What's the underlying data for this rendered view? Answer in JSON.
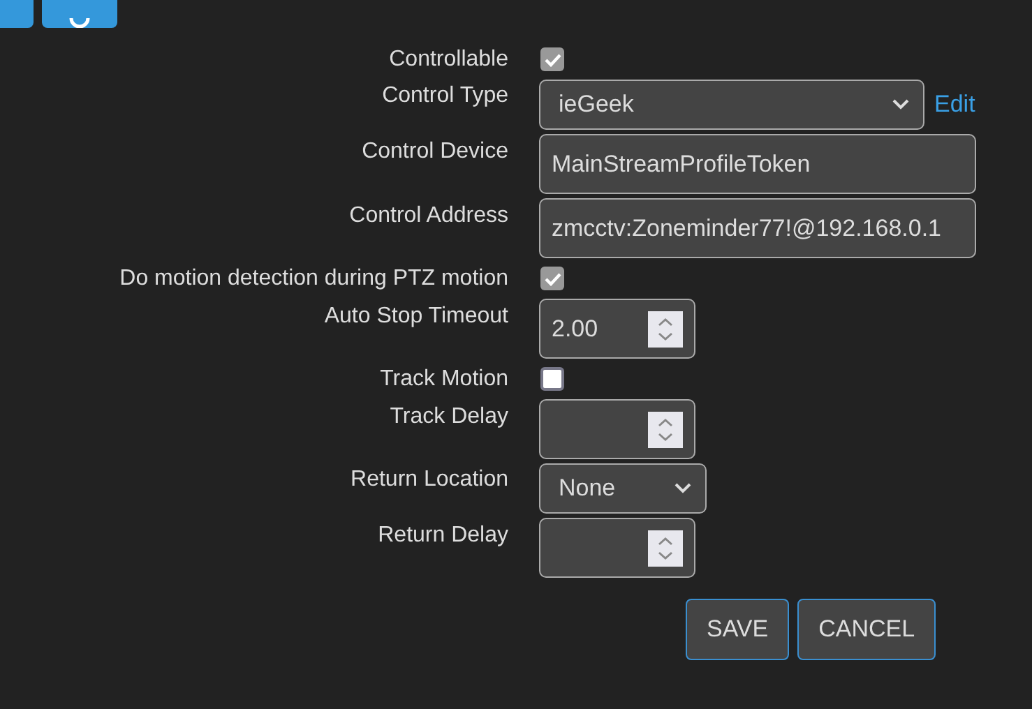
{
  "toolbar": {
    "buttons": [
      {
        "kind": "plain"
      },
      {
        "kind": "refresh"
      }
    ]
  },
  "fields": [
    {
      "label": "Controllable",
      "kind": "checkbox",
      "checked": true
    },
    {
      "label": "Control Type",
      "kind": "select",
      "value": "ieGeek",
      "link": "Edit"
    },
    {
      "label": "Control Device",
      "kind": "text",
      "value": "MainStreamProfileToken"
    },
    {
      "label": "Control Address",
      "kind": "text",
      "value": "zmcctv:Zoneminder77!@192.168.0.1"
    },
    {
      "label": "Do motion detection during PTZ motion",
      "kind": "checkbox",
      "checked": true
    },
    {
      "label": "Auto Stop Timeout",
      "kind": "number",
      "value": "2.00"
    },
    {
      "label": "Track Motion",
      "kind": "checkbox",
      "checked": false
    },
    {
      "label": "Track Delay",
      "kind": "number"
    },
    {
      "label": "Return Location",
      "kind": "select",
      "value": "None"
    },
    {
      "label": "Return Delay",
      "kind": "number"
    }
  ],
  "buttons": [
    {
      "label": "SAVE"
    },
    {
      "label": "CANCEL"
    }
  ]
}
